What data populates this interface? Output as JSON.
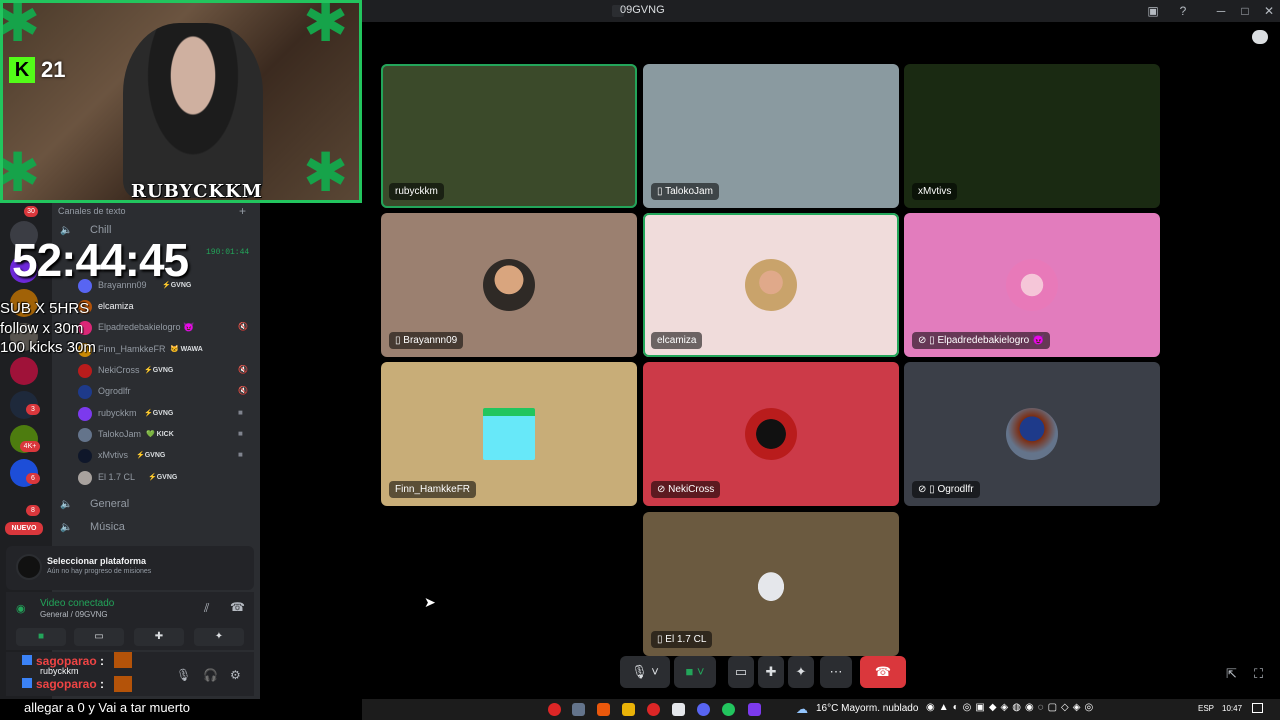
{
  "window": {
    "title": "09GVNG"
  },
  "cam": {
    "streamer_name": "RUBYCKKM",
    "kick_count": "21"
  },
  "stream_overlay": {
    "timer": "52:44:45",
    "lines": [
      "SUB X 5HRS",
      "follow x 30m",
      "100 kicks 30m"
    ]
  },
  "sidebar": {
    "channels_header": "Canales de texto",
    "channels": [
      {
        "name": "Chill"
      },
      {
        "name": "General"
      },
      {
        "name": "Música"
      }
    ],
    "voice_timer": "190:01:44",
    "members": [
      {
        "name": "Brayannn09",
        "tag": "⚡GVNG"
      },
      {
        "name": "elcamiza",
        "tag": ""
      },
      {
        "name": "Elpadredebakielogro 😈",
        "tag": ""
      },
      {
        "name": "Finn_HamkkeFR",
        "tag": "🐱 WAWA"
      },
      {
        "name": "NekiCross",
        "tag": "⚡GVNG"
      },
      {
        "name": "Ogrodlfr",
        "tag": ""
      },
      {
        "name": "rubyckkm",
        "tag": "⚡GVNG"
      },
      {
        "name": "TalokoJam",
        "tag": "💚 KICK"
      },
      {
        "name": "xMvtivs",
        "tag": "⚡GVNG"
      },
      {
        "name": "El 1.7 CL",
        "tag": "⚡GVNG"
      }
    ],
    "server_badges": [
      "30",
      "3",
      "4K+",
      "6",
      "8"
    ],
    "nuevo_label": "NUEVO"
  },
  "quest": {
    "title": "Seleccionar plataforma",
    "subtitle": "Aún no hay progreso de misiones"
  },
  "voice": {
    "status": "Video conectado",
    "channel": "General / 09GVNG"
  },
  "chat": {
    "lines": [
      {
        "user": "sagoparao",
        "text": ":"
      },
      {
        "user": "sagoparao",
        "text": ":"
      }
    ],
    "under_user": "rubyckkm"
  },
  "tiles": [
    {
      "name": "rubyckkm",
      "bg": "#3b4a2a"
    },
    {
      "name": "TalokoJam",
      "bg": "#8a9aa0"
    },
    {
      "name": "xMvtivs",
      "bg": "#1a2a12"
    },
    {
      "name": "Brayannn09",
      "bg": "#9b8070"
    },
    {
      "name": "elcamiza",
      "bg": "#f0dcdb"
    },
    {
      "name": "Elpadredebakielogro 😈",
      "bg": "#e27cbd"
    },
    {
      "name": "Finn_HamkkeFR",
      "bg": "#c8ad78"
    },
    {
      "name": "NekiCross",
      "bg": "#cc3a48"
    },
    {
      "name": "Ogrodlfr",
      "bg": "#3b3f48"
    },
    {
      "name": "El 1.7 CL",
      "bg": "#6b5a40"
    }
  ],
  "ticker": {
    "text": "allegar a 0 y Vai a tar muerto"
  },
  "taskbar": {
    "weather": "16°C  Mayorm. nublado",
    "lang": "ESP",
    "time": "10:47"
  }
}
